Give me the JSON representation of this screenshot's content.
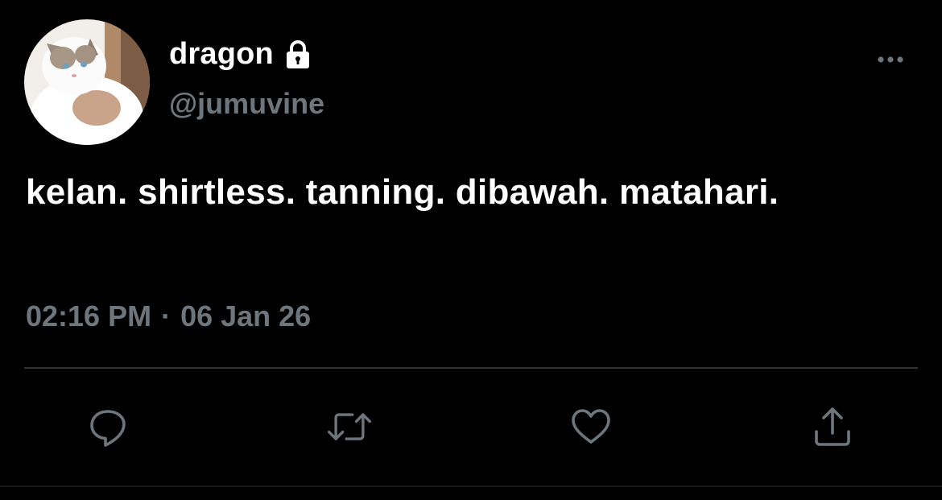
{
  "user": {
    "display_name": "dragon",
    "handle": "@jumuvine",
    "protected_icon": "lock-icon",
    "avatar": "cat-avatar"
  },
  "tweet": {
    "text": "kelan. shirtless. tanning. dibawah. matahari.",
    "time": "02:16 PM",
    "separator": "·",
    "date": "06 Jan 26"
  },
  "actions": [
    {
      "name": "reply",
      "icon": "comment-icon"
    },
    {
      "name": "retweet",
      "icon": "retweet-icon"
    },
    {
      "name": "like",
      "icon": "heart-icon"
    },
    {
      "name": "share",
      "icon": "share-icon"
    }
  ],
  "menu": {
    "icon": "more-dots-icon"
  },
  "colors": {
    "background": "#000000",
    "primary_text": "#ffffff",
    "secondary_text": "#6e767d",
    "divider": "#2f3336"
  }
}
